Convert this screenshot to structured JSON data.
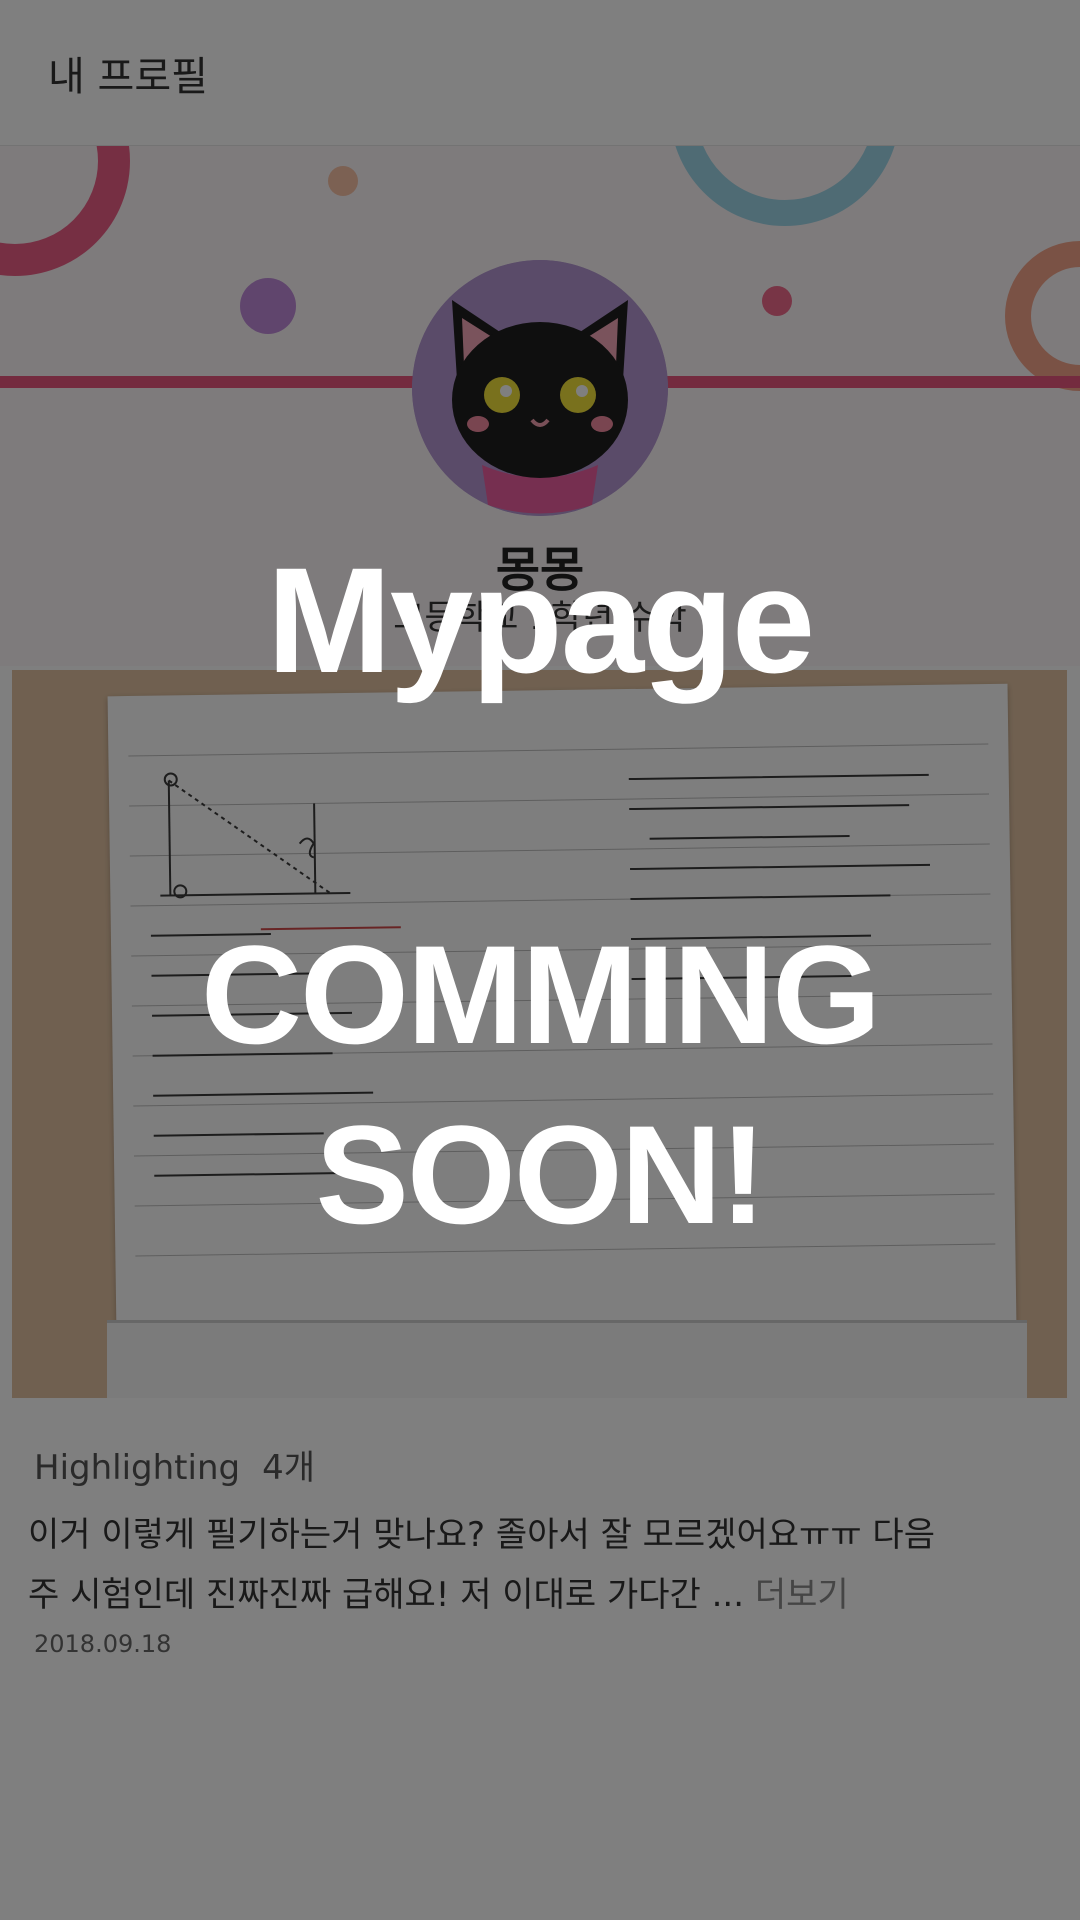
{
  "header": {
    "title": "내 프로필"
  },
  "profile": {
    "name": "몽몽",
    "subtitle": "고등학교 1학년 수학"
  },
  "post": {
    "highlight_label": "Highlighting",
    "highlight_count": "4개",
    "body": "이거 이렇게 필기하는거 맞나요? 졸아서 잘 모르겠어요ㅠㅠ 다음주 시험인데 진짜진짜 급해요! 저 이대로 가다간 ...",
    "more_label": "더보기",
    "date": "2018.09.18"
  },
  "overlay": {
    "title": "Mypage",
    "line1": "COMMING",
    "line2": "SOON!"
  },
  "colors": {
    "accent_pink": "#e9577f",
    "overlay": "rgba(0,0,0,0.5)"
  }
}
